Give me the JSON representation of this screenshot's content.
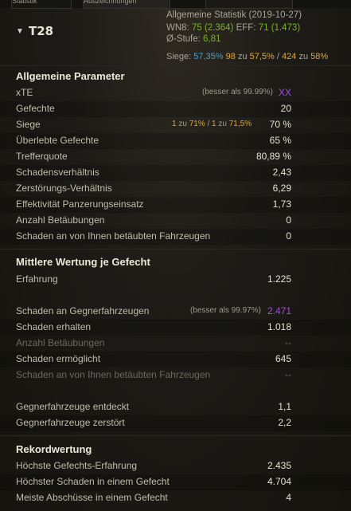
{
  "tabs": [
    "Statistik",
    "Auszeichnungen",
    ""
  ],
  "vehicle": {
    "name": "T28"
  },
  "summary": {
    "title": "Allgemeine Statistik (2019-10-27)",
    "wn8_label": "WN8:",
    "wn8_value": "75",
    "wn8_paren": "(2.364)",
    "eff_label": "EFF:",
    "eff_value": "71",
    "eff_paren": "(1.473)",
    "tier_label": "Ø-Stufe:",
    "tier_value": "6,81",
    "wins_label": "Siege:",
    "wins_pct": "57,35%",
    "wins_n1": "98",
    "wins_zu1": "zu",
    "wins_pct2": "57,5%",
    "wins_slash": "/",
    "wins_n2": "424",
    "wins_zu2": "zu",
    "wins_pct3": "58%"
  },
  "general": {
    "title": "Allgemeine Parameter",
    "rows": [
      {
        "label": "xTE",
        "value": "XX",
        "note": "(besser als 99.99%)"
      },
      {
        "label": "Gefechte",
        "value": "20"
      },
      {
        "label": "Siege",
        "value": "70 %",
        "note_a": "1",
        "note_zu": "zu",
        "note_b": "71%",
        "note_sl": "/",
        "note_c": "1",
        "note_zu2": "zu",
        "note_d": "71,5%"
      },
      {
        "label": "Überlebte Gefechte",
        "value": "65 %"
      },
      {
        "label": "Trefferquote",
        "value": "80,89 %"
      },
      {
        "label": "Schadensverhältnis",
        "value": "2,43"
      },
      {
        "label": "Zerstörungs-Verhältnis",
        "value": "6,29"
      },
      {
        "label": "Effektivität Panzerungseinsatz",
        "value": "1,73"
      },
      {
        "label": "Anzahl Betäubungen",
        "value": "0"
      },
      {
        "label": "Schaden an von Ihnen betäubten Fahrzeugen",
        "value": "0"
      }
    ]
  },
  "average": {
    "title": "Mittlere Wertung je Gefecht",
    "rows": [
      {
        "label": "Erfahrung",
        "value": "1.225"
      },
      {
        "label": "Schaden an Gegnerfahrzeugen",
        "value": "2.471",
        "note": "(besser als 99.97%)"
      },
      {
        "label": "Schaden erhalten",
        "value": "1.018"
      },
      {
        "label": "Anzahl Betäubungen",
        "value": "--"
      },
      {
        "label": "Schaden ermöglicht",
        "value": "645"
      },
      {
        "label": "Schaden an von Ihnen betäubten Fahrzeugen",
        "value": "--"
      },
      {
        "label": "Gegnerfahrzeuge entdeckt",
        "value": "1,1"
      },
      {
        "label": "Gegnerfahrzeuge zerstört",
        "value": "2,2"
      }
    ]
  },
  "records": {
    "title": "Rekordwertung",
    "rows": [
      {
        "label": "Höchste Gefechts-Erfahrung",
        "value": "2.435"
      },
      {
        "label": "Höchster Schaden in einem Gefecht",
        "value": "4.704"
      },
      {
        "label": "Meiste Abschüsse in einem Gefecht",
        "value": "4"
      }
    ]
  },
  "colors": {
    "green": "#78b41e",
    "blue": "#3fa2d9",
    "orange": "#e1a735",
    "purple": "#a44be0"
  }
}
